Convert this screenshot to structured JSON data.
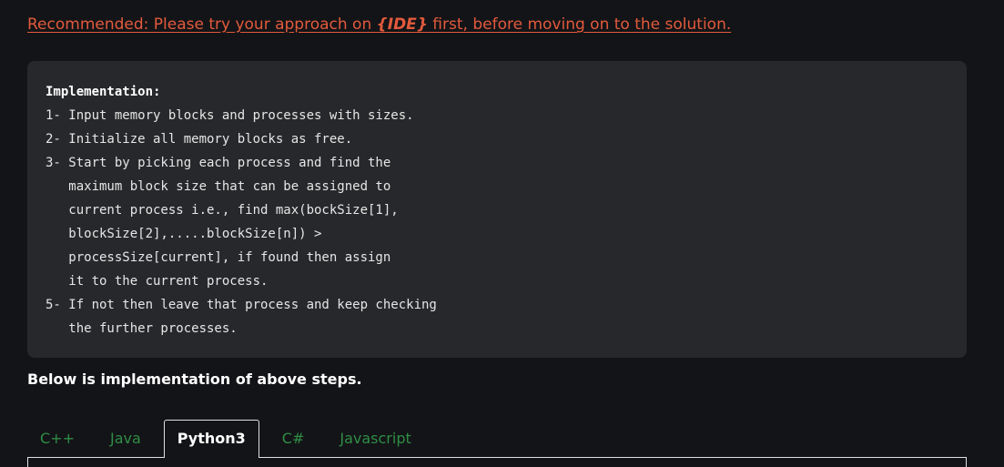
{
  "recommended": {
    "prefix": "Recommended: Please try your approach on ",
    "ide": "{IDE}",
    "suffix": " first, before moving on to the solution."
  },
  "implementation": {
    "title": "Implementation:",
    "body": "1- Input memory blocks and processes with sizes.\n2- Initialize all memory blocks as free.\n3- Start by picking each process and find the\n   maximum block size that can be assigned to\n   current process i.e., find max(bockSize[1],\n   blockSize[2],.....blockSize[n]) >\n   processSize[current], if found then assign\n   it to the current process.\n5- If not then leave that process and keep checking\n   the further processes."
  },
  "below_text": "Below is implementation of above steps.",
  "tabs": [
    {
      "label": "C++"
    },
    {
      "label": "Java"
    },
    {
      "label": "Python3"
    },
    {
      "label": "C#"
    },
    {
      "label": "Javascript"
    }
  ],
  "colors": {
    "accent_link": "#e25a3c",
    "tab_inactive": "#2f8d46",
    "code_bg": "#27282b",
    "page_bg": "#131417"
  }
}
